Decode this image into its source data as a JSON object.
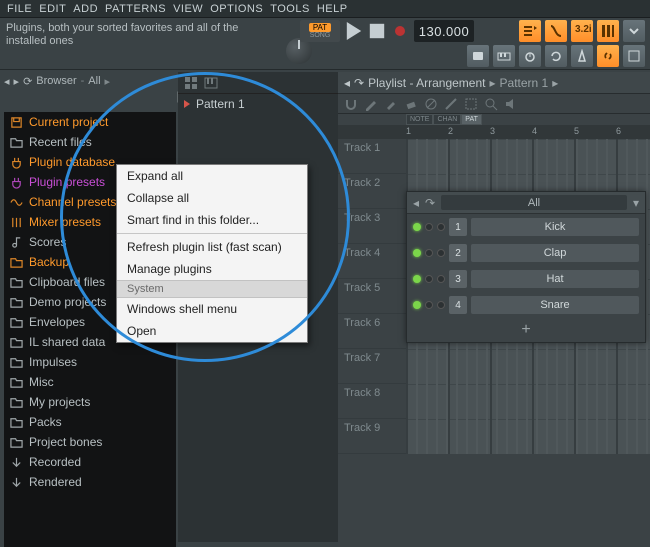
{
  "menu": [
    "FILE",
    "EDIT",
    "ADD",
    "PATTERNS",
    "VIEW",
    "OPTIONS",
    "TOOLS",
    "HELP"
  ],
  "hint": "Plugins, both your sorted favorites and all of the installed ones",
  "pat_label_short": "PAT",
  "pat_label_song": "SONG",
  "tempo": "130.000",
  "top_buttons_row1": [
    "pl",
    "cr",
    "32i",
    "mx",
    "more"
  ],
  "top_buttons_row2": [
    "midi",
    "key",
    "rec",
    "loop",
    "metro",
    "link",
    "snap"
  ],
  "browser": {
    "title": "Browser",
    "filter": "All",
    "items": [
      {
        "label": "Current project",
        "kind": "sel",
        "icon": "disk"
      },
      {
        "label": "Recent files",
        "kind": "folder",
        "icon": "folder"
      },
      {
        "label": "Plugin database",
        "kind": "sel",
        "icon": "plug"
      },
      {
        "label": "Plugin presets",
        "kind": "hl",
        "icon": "plug"
      },
      {
        "label": "Channel presets",
        "kind": "sel",
        "icon": "wave"
      },
      {
        "label": "Mixer presets",
        "kind": "sel",
        "icon": "sliders"
      },
      {
        "label": "Scores",
        "kind": "folder",
        "icon": "note"
      },
      {
        "label": "Backup",
        "kind": "sel",
        "icon": "folder"
      },
      {
        "label": "Clipboard files",
        "kind": "folder",
        "icon": "folder"
      },
      {
        "label": "Demo projects",
        "kind": "folder",
        "icon": "folder"
      },
      {
        "label": "Envelopes",
        "kind": "folder",
        "icon": "folder"
      },
      {
        "label": "IL shared data",
        "kind": "folder",
        "icon": "folder"
      },
      {
        "label": "Impulses",
        "kind": "folder",
        "icon": "folder"
      },
      {
        "label": "Misc",
        "kind": "folder",
        "icon": "folder"
      },
      {
        "label": "My projects",
        "kind": "folder",
        "icon": "folder"
      },
      {
        "label": "Packs",
        "kind": "folder",
        "icon": "folder"
      },
      {
        "label": "Project bones",
        "kind": "folder",
        "icon": "folder"
      },
      {
        "label": "Recorded",
        "kind": "folder",
        "icon": "arrowdn"
      },
      {
        "label": "Rendered",
        "kind": "folder",
        "icon": "arrowdn"
      }
    ]
  },
  "pattern_panel": {
    "current": "Pattern 1"
  },
  "context_menu": {
    "items": [
      {
        "label": "Expand all",
        "type": "mi"
      },
      {
        "label": "Collapse all",
        "type": "mi"
      },
      {
        "label": "Smart find in this folder...",
        "type": "mi"
      },
      {
        "type": "sep"
      },
      {
        "label": "Refresh plugin list (fast scan)",
        "type": "mi"
      },
      {
        "label": "Manage plugins",
        "type": "mi"
      },
      {
        "label": "System",
        "type": "head"
      },
      {
        "label": "Windows shell menu",
        "type": "mi"
      },
      {
        "label": "Open",
        "type": "mi"
      }
    ]
  },
  "playlist": {
    "title": "Playlist - Arrangement",
    "crumb": "Pattern 1",
    "ruler_mode_tabs": [
      "NOTE",
      "CHAN",
      "PAT"
    ],
    "ruler_numbers": [
      1,
      2,
      3,
      4,
      5,
      6
    ],
    "tracks": [
      "Track 1",
      "Track 2",
      "Track 3",
      "Track 4",
      "Track 5",
      "Track 6",
      "Track 7",
      "Track 8",
      "Track 9"
    ]
  },
  "channel_rack": {
    "filter": "All",
    "channels": [
      {
        "n": "1",
        "name": "Kick"
      },
      {
        "n": "2",
        "name": "Clap"
      },
      {
        "n": "3",
        "name": "Hat"
      },
      {
        "n": "4",
        "name": "Snare"
      }
    ]
  }
}
